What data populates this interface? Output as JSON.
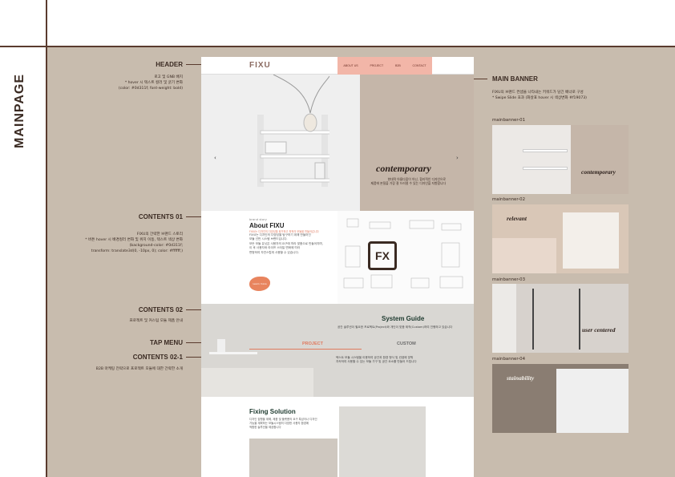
{
  "page": {
    "title": "MAINPAGE"
  },
  "annotations": {
    "header": {
      "label": "HEADER",
      "note": "로고 및 GNB 배치\n* hover 시 텍스트 컬러 및 굵기 변화\n(color: #0d311f; font-weight: bold)"
    },
    "contents01": {
      "label": "CONTENTS 01",
      "note": "FIXU의 간략한 브랜드 스토리\n* 버튼 hover 시 배경컬러 변화 및 위치 이동, 텍스트 색상 변화\n(background-color: #0d311f;\ntransform: translate3d(0, -10px, 0); color: #ffffff;)"
    },
    "contents02": {
      "label": "CONTENTS 02",
      "note": "프로젝트 및 커스텀 모듈 제품 안내"
    },
    "tapmenu": {
      "label": "TAP MENU"
    },
    "contents021": {
      "label": "CONTENTS 02-1",
      "note": "B2B 마케팅 전략으로 프로젝트 모듈에 대한 간략한 소개"
    },
    "mainbanner": {
      "label": "MAIN BANNER",
      "note": "FIXU의 브랜드 컨셉을 나타내는 키워드가 담긴 배너로 구성\n* Swipe Slide 효과 (화살표 hover 시 색상변화 #f19073)"
    }
  },
  "mockup": {
    "logo": "FIXU",
    "nav": [
      "ABOUT US",
      "PROJECT",
      "B2B",
      "CONTACT"
    ],
    "banner": {
      "headline": "contemporary",
      "sub": "현대적 아름다움이 아닌, 합리적인 디자인으로\n제품에 본질을 가장 잘 드러낼 수 있는 디자인을 지향합니다",
      "prev": "‹",
      "next": "›"
    },
    "about": {
      "eyebrow": "brand story",
      "title": "About FIXU",
      "sub": "FIXU는 디자인의 다양성을 탐구하고 최적의 모듈을 만들어갑니다",
      "body": "FIXU는 디자인의 다양성을 탐구하기 위해 만들어진\n모듈 선반 시스템 브랜드입니다.\n모든 모듈 유닛은 사용자의 요구에 따라 맞춤으로 만들어지며,\n이 후 사용자와 라이프 스타일 변화에 따라\n변형하여 자연스럽게 사용할 수 있습니다.",
      "button": "Learn more"
    },
    "system": {
      "title": "System Guide",
      "sub": "공간 솔루션이 필요한 프로젝트(Project)와 개인이 맞춤 제작(Custom)하여 진행하고 있습니다",
      "tabs": [
        "PROJECT",
        "CUSTOM"
      ],
      "desc": "텍스트 모듈 시스템을 이용하여 공간과 환경 형식 및 컨셉에 맞춰\n지속하여 사용할 수 있는 모듈 가구 및 공간 요소를 만들어 드립니다"
    },
    "fixing": {
      "title": "Fixing Solution",
      "body": "디자인 집행을 위해, 제품 및 플랫폼의 요구 특성이나 디자인\n기능을 계획하는 모듈시스템의 다양한 사용자 환경에\n적합한 솔루션을 제공합니다"
    }
  },
  "banners": [
    {
      "label": "mainbanner-01",
      "text": "contemporary"
    },
    {
      "label": "mainbanner-02",
      "text": "relevant"
    },
    {
      "label": "mainbanner-03",
      "text": "user centered"
    },
    {
      "label": "mainbanner-04",
      "text": "stainability"
    }
  ],
  "colors": {
    "accent": "#f19073",
    "dark": "#0d311f",
    "brown": "#5a3b2e",
    "tan": "#c8bcae"
  }
}
